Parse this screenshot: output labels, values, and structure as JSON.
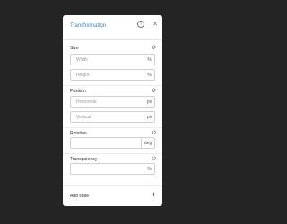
{
  "panel": {
    "title": "Transformation",
    "help_icon": "help-circle-icon",
    "close_icon": "close-icon"
  },
  "size": {
    "label": "Size",
    "width_placeholder": "Width",
    "width_unit": "%",
    "height_placeholder": "Height",
    "height_unit": "%"
  },
  "position": {
    "label": "Position",
    "horizontal_placeholder": "Horizontal",
    "horizontal_unit": "px",
    "vertical_placeholder": "Vertical",
    "vertical_unit": "px"
  },
  "rotation": {
    "label": "Rotation",
    "value": "",
    "unit": "deg"
  },
  "transparency": {
    "label": "Transparency",
    "value": "",
    "unit": "%"
  },
  "footer": {
    "add_state_label": "Add state",
    "plus_icon": "+"
  },
  "colors": {
    "background": "#242424",
    "panel": "#ffffff",
    "title_accent": "#3a86c8"
  }
}
